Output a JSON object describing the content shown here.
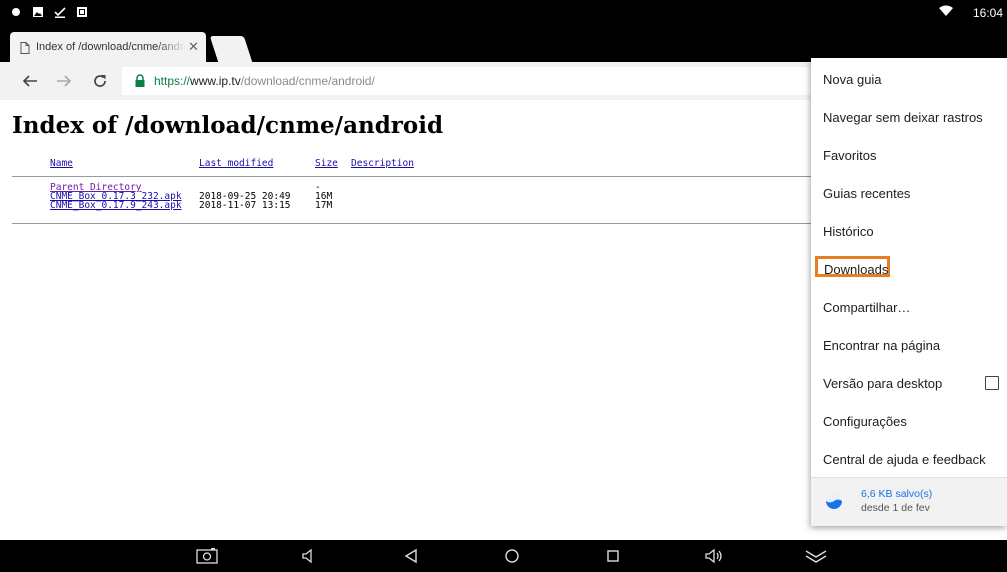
{
  "status_bar": {
    "time": "16:04",
    "left_icons": [
      "notification-dot-icon",
      "image-icon",
      "download-done-icon",
      "screenshot-icon"
    ],
    "right_icons": [
      "wifi-icon"
    ]
  },
  "tab": {
    "title": "Index of /download/cnme/android/",
    "close_icon": "close-icon"
  },
  "toolbar": {
    "url_scheme": "https://",
    "url_host": "www.ip.tv",
    "url_path": "/download/cnme/android/"
  },
  "page": {
    "title": "Index of /download/cnme/android",
    "columns": [
      "Name",
      "Last modified",
      "Size",
      "Description"
    ],
    "rows": [
      {
        "name": "Parent Directory",
        "modified": "",
        "size": "-",
        "description": ""
      },
      {
        "name": "CNME_Box_0.17.3_232.apk",
        "modified": "2018-09-25 20:49",
        "size": "16M",
        "description": ""
      },
      {
        "name": "CNME_Box_0.17.9_243.apk",
        "modified": "2018-11-07 13:15",
        "size": "17M",
        "description": ""
      }
    ]
  },
  "menu": {
    "items": [
      "Nova guia",
      "Navegar sem deixar rastros",
      "Favoritos",
      "Guias recentes",
      "Histórico",
      "Downloads",
      "Compartilhar…",
      "Encontrar na página",
      "Versão para desktop",
      "Configurações",
      "Central de ajuda e feedback"
    ],
    "highlighted_item": "Downloads",
    "highlight_color": "#e67e22",
    "desktop_checkbox_checked": false,
    "data_saver": {
      "value": "6,6 KB salvo(s)",
      "since": "desde 1 de fev"
    }
  },
  "nav_bar": {
    "icons": [
      "screenshot-icon",
      "volume-down-icon",
      "back-icon",
      "home-icon",
      "recents-icon",
      "volume-up-icon",
      "collapse-icon"
    ]
  },
  "colors": {
    "link": "#1a0dab",
    "visited_link": "#681da8",
    "secure_green": "#0b8043",
    "accent": "#1a73e8"
  }
}
